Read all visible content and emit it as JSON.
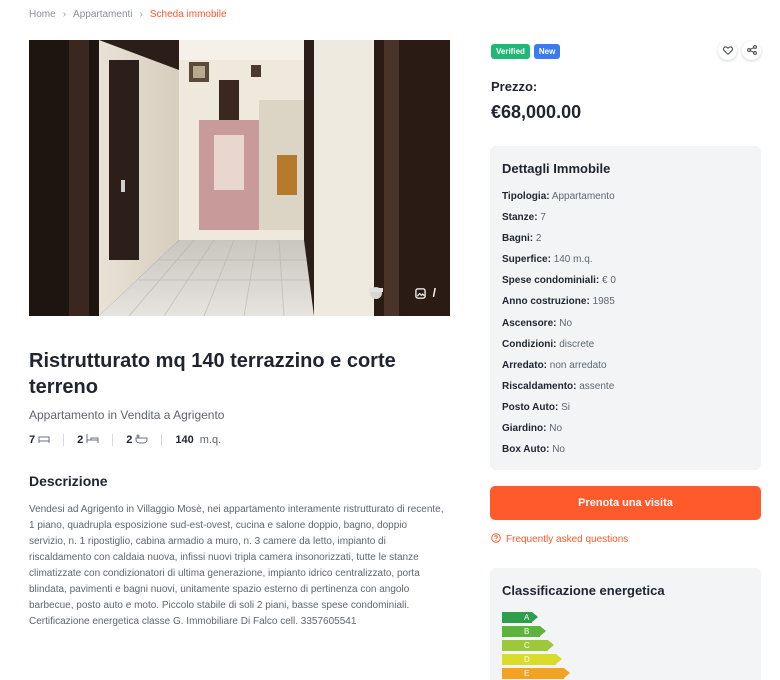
{
  "breadcrumb": {
    "home": "Home",
    "section": "Appartamenti",
    "current": "Scheda immobile"
  },
  "photo": {
    "counter": "/"
  },
  "listing": {
    "title": "Ristrutturato mq 140 terrazzino e corte terreno",
    "subtitle": "Appartamento in Vendita a Agrigento",
    "rooms": "7",
    "beds": "2",
    "baths": "2",
    "area": "140",
    "area_unit": "m.q."
  },
  "description": {
    "heading": "Descrizione",
    "text": "Vendesi ad Agrigento in Villaggio Mosè, nei appartamento interamente ristrutturato di recente, 1 piano, quadrupla esposizione sud-est-ovest, cucina e salone doppio, bagno, doppio servizio, n. 1 ripostiglio, cabina armadio a muro, n. 3 camere da letto, impianto di riscaldamento con caldaia nuova, infissi nuovi tripla camera insonorizzati, tutte le stanze climatizzate con condizionatori di ultima generazione, impianto idrico centralizzato, porta blindata, pavimenti e bagni nuovi, unitamente spazio esterno di pertinenza con angolo barbecue, posto auto e moto. Piccolo stabile di soli 2 piani, basse spese condominiali. Certificazione energetica classe G. Immobiliare Di Falco cell. 3357605541"
  },
  "badges": {
    "verified": "Verified",
    "new": "New"
  },
  "price": {
    "label": "Prezzo:",
    "value": "€68,000.00"
  },
  "details": {
    "heading": "Dettagli Immobile",
    "rows": [
      {
        "label": "Tipologia:",
        "value": "Appartamento"
      },
      {
        "label": "Stanze:",
        "value": "7"
      },
      {
        "label": "Bagni:",
        "value": "2"
      },
      {
        "label": "Superfice:",
        "value": "140 m.q."
      },
      {
        "label": "Spese condominiali:",
        "value": "€ 0"
      },
      {
        "label": "Anno costruzione:",
        "value": "1985"
      },
      {
        "label": "Ascensore:",
        "value": "No"
      },
      {
        "label": "Condizioni:",
        "value": "discrete"
      },
      {
        "label": "Arredato:",
        "value": "non arredato"
      },
      {
        "label": "Riscaldamento:",
        "value": "assente"
      },
      {
        "label": "Posto Auto:",
        "value": "Si"
      },
      {
        "label": "Giardino:",
        "value": "No"
      },
      {
        "label": "Box Auto:",
        "value": "No"
      }
    ]
  },
  "cta": {
    "label": "Prenota una visita"
  },
  "faq": {
    "label": "Frequently asked questions"
  },
  "energy": {
    "heading": "Classificazione energetica",
    "classes": [
      {
        "label": "A",
        "color": "#2e9e4a"
      },
      {
        "label": "B",
        "color": "#5db33c"
      },
      {
        "label": "C",
        "color": "#9cc83a"
      },
      {
        "label": "D",
        "color": "#d9dc2a"
      },
      {
        "label": "E",
        "color": "#f2a324"
      }
    ]
  },
  "colors": {
    "accent": "#ff5a2c",
    "verified": "#1fb877",
    "new": "#3a7bf0",
    "panel": "#f3f4f6"
  },
  "icons": {
    "like": "heart-icon",
    "share": "share-icon",
    "gallery": "image-icon",
    "faq": "question-circle-icon"
  }
}
